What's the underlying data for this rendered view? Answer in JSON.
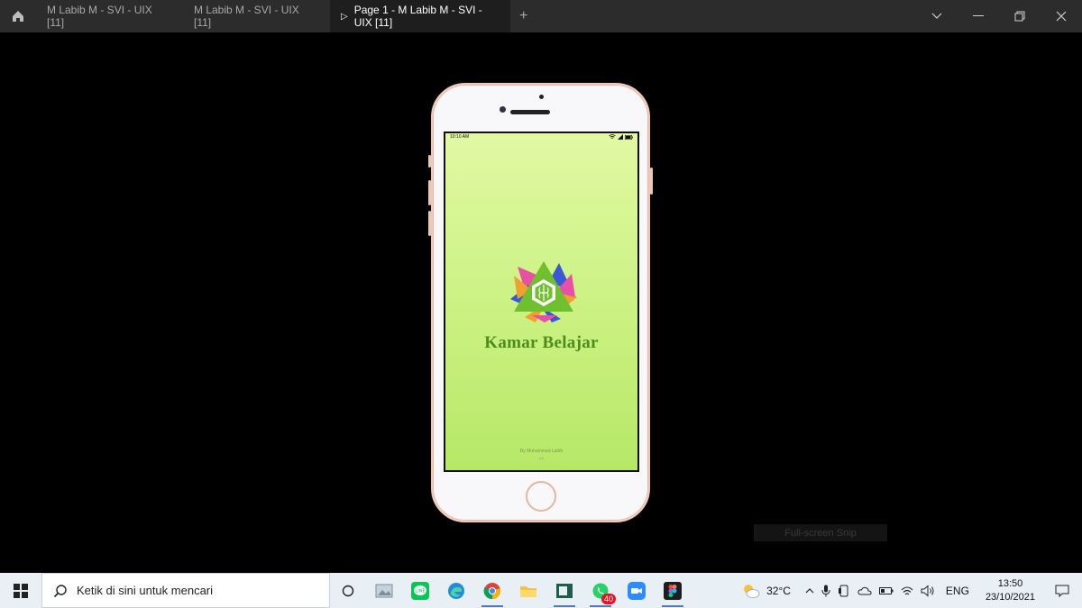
{
  "tabs": [
    {
      "label": "M Labib M - SVI - UIX [11]"
    },
    {
      "label": "M Labib M - SVI - UIX [11]"
    },
    {
      "label": "Page 1 - M Labib M - SVI - UIX [11]",
      "active": true
    }
  ],
  "phone": {
    "status_time": "10:10 AM",
    "app_title": "Kamar Belajar",
    "byline": "By Muhammad Labib",
    "version": "v.1"
  },
  "snip_label": "Full-screen Snip",
  "taskbar": {
    "search_placeholder": "Ketik di sini untuk mencari",
    "whatsapp_badge": "40",
    "weather": "32°C",
    "language": "ENG",
    "time": "13:50",
    "date": "23/10/2021"
  },
  "colors": {
    "accent_green": "#4c8c1d",
    "screen_top": "#e1f9a3",
    "screen_bottom": "#b6e866"
  }
}
